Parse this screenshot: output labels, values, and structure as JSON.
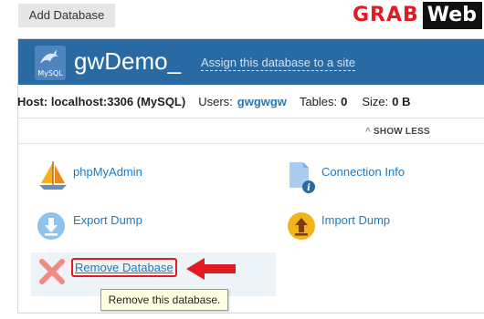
{
  "toolbar": {
    "add_database_label": "Add Database"
  },
  "watermark": {
    "part1": "GRAB",
    "part2": "Web"
  },
  "database": {
    "icon_caption": "MySQL",
    "name": "gwDemo_",
    "assign_link": "Assign this database to a site",
    "host_label": "Host: localhost:3306 (MySQL)",
    "users_label": "Users:",
    "users_value": "gwgwgw",
    "tables_label": "Tables:",
    "tables_value": "0",
    "size_label": "Size:",
    "size_value": "0 B",
    "show_less": "SHOW LESS"
  },
  "tools": [
    {
      "label": "phpMyAdmin",
      "icon": "sailboat-icon"
    },
    {
      "label": "Connection Info",
      "icon": "document-info-icon"
    },
    {
      "label": "Export Dump",
      "icon": "download-icon"
    },
    {
      "label": "Import Dump",
      "icon": "upload-icon"
    },
    {
      "label": "Remove Database",
      "icon": "remove-x-icon"
    }
  ],
  "tooltip": "Remove this database.",
  "colors": {
    "header_bg": "#2a6aa3",
    "link": "#1e7bc2",
    "highlight_red": "#e21b22"
  }
}
